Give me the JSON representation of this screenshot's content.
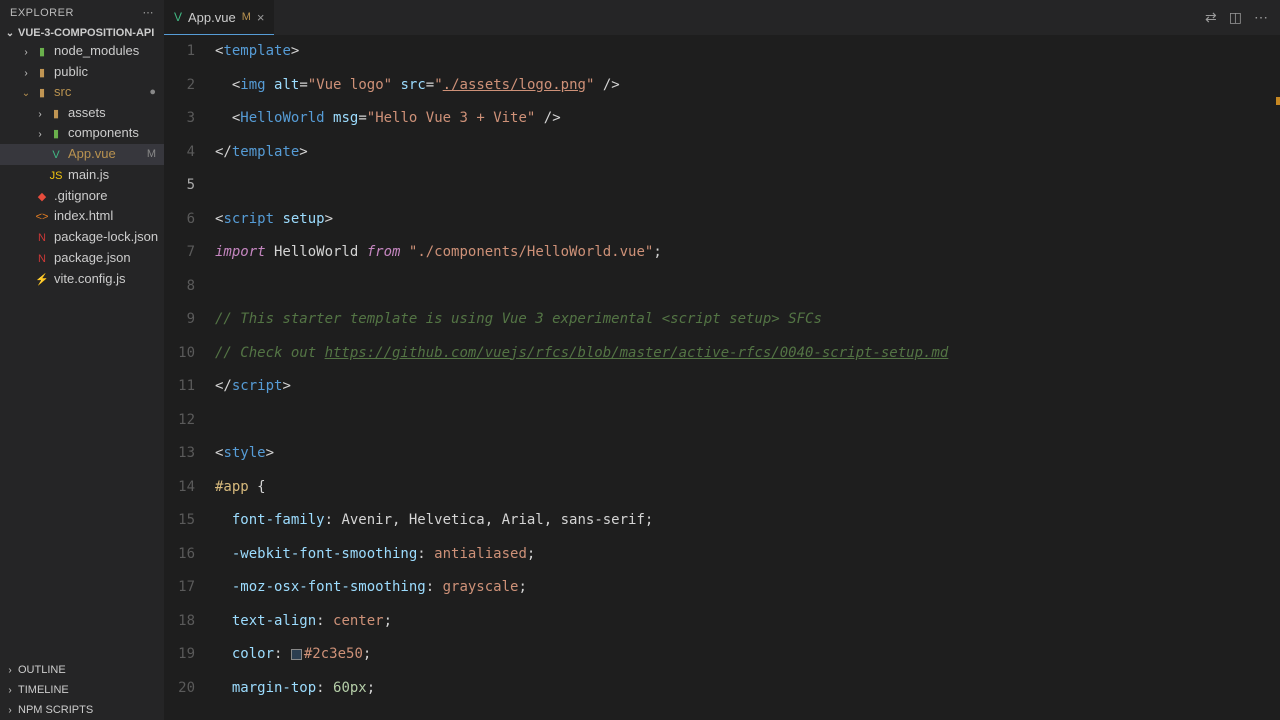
{
  "explorer": {
    "title": "EXPLORER",
    "project": "VUE-3-COMPOSITION-API",
    "tree": [
      {
        "name": "node_modules",
        "type": "folder",
        "indent": 1,
        "chev": "›",
        "iconClass": "folder-icon green"
      },
      {
        "name": "public",
        "type": "folder",
        "indent": 1,
        "chev": "›",
        "iconClass": "folder-icon"
      },
      {
        "name": "src",
        "type": "folder",
        "indent": 1,
        "chev": "⌄",
        "iconClass": "folder-icon",
        "modified": true,
        "badge": "●"
      },
      {
        "name": "assets",
        "type": "folder",
        "indent": 2,
        "chev": "›",
        "iconClass": "folder-icon"
      },
      {
        "name": "components",
        "type": "folder",
        "indent": 2,
        "chev": "›",
        "iconClass": "folder-icon green"
      },
      {
        "name": "App.vue",
        "type": "file",
        "indent": 2,
        "iconClass": "vue-icon",
        "iconText": "V",
        "modified": true,
        "badge": "M",
        "active": true
      },
      {
        "name": "main.js",
        "type": "file",
        "indent": 2,
        "iconClass": "js-icon",
        "iconText": "JS"
      },
      {
        "name": ".gitignore",
        "type": "file",
        "indent": 1,
        "iconClass": "git-icon",
        "iconText": "◆"
      },
      {
        "name": "index.html",
        "type": "file",
        "indent": 1,
        "iconClass": "html-icon",
        "iconText": "<>"
      },
      {
        "name": "package-lock.json",
        "type": "file",
        "indent": 1,
        "iconClass": "npm-icon",
        "iconText": "N"
      },
      {
        "name": "package.json",
        "type": "file",
        "indent": 1,
        "iconClass": "npm-icon",
        "iconText": "N"
      },
      {
        "name": "vite.config.js",
        "type": "file",
        "indent": 1,
        "iconClass": "js-icon",
        "iconText": "⚡"
      }
    ],
    "panels": [
      "OUTLINE",
      "TIMELINE",
      "NPM SCRIPTS"
    ]
  },
  "tabs": {
    "open": {
      "name": "App.vue",
      "status": "M"
    }
  },
  "editor": {
    "lines": [
      {
        "n": 1,
        "tokens": [
          [
            "punct",
            "<"
          ],
          [
            "tag",
            "template"
          ],
          [
            "punct",
            ">"
          ]
        ]
      },
      {
        "n": 2,
        "indent": 1,
        "tokens": [
          [
            "punct",
            "<"
          ],
          [
            "tag",
            "img"
          ],
          [
            "plain",
            " "
          ],
          [
            "attr",
            "alt"
          ],
          [
            "punct",
            "="
          ],
          [
            "str",
            "\"Vue logo\""
          ],
          [
            "plain",
            " "
          ],
          [
            "attr",
            "src"
          ],
          [
            "punct",
            "="
          ],
          [
            "str",
            "\""
          ],
          [
            "str-u",
            "./assets/logo.png"
          ],
          [
            "str",
            "\""
          ],
          [
            "plain",
            " "
          ],
          [
            "punct",
            "/>"
          ]
        ]
      },
      {
        "n": 3,
        "indent": 1,
        "tokens": [
          [
            "punct",
            "<"
          ],
          [
            "tag",
            "HelloWorld"
          ],
          [
            "plain",
            " "
          ],
          [
            "attr",
            "msg"
          ],
          [
            "punct",
            "="
          ],
          [
            "str",
            "\"Hello Vue 3 + Vite\""
          ],
          [
            "plain",
            " "
          ],
          [
            "punct",
            "/>"
          ]
        ]
      },
      {
        "n": 4,
        "tokens": [
          [
            "punct",
            "</"
          ],
          [
            "tag",
            "template"
          ],
          [
            "punct",
            ">"
          ]
        ]
      },
      {
        "n": 5,
        "active": true,
        "tokens": []
      },
      {
        "n": 6,
        "tokens": [
          [
            "punct",
            "<"
          ],
          [
            "tag",
            "script"
          ],
          [
            "plain",
            " "
          ],
          [
            "attr",
            "setup"
          ],
          [
            "punct",
            ">"
          ]
        ]
      },
      {
        "n": 7,
        "tokens": [
          [
            "kw",
            "import"
          ],
          [
            "plain",
            " HelloWorld "
          ],
          [
            "kw",
            "from"
          ],
          [
            "plain",
            " "
          ],
          [
            "str",
            "\"./components/HelloWorld.vue\""
          ],
          [
            "punct",
            ";"
          ]
        ]
      },
      {
        "n": 8,
        "tokens": []
      },
      {
        "n": 9,
        "tokens": [
          [
            "comment",
            "// This starter template is using Vue 3 experimental <script setup> SFCs"
          ]
        ]
      },
      {
        "n": 10,
        "tokens": [
          [
            "comment",
            "// Check out "
          ],
          [
            "comment-u",
            "https://github.com/vuejs/rfcs/blob/master/active-rfcs/0040-script-setup.md"
          ]
        ]
      },
      {
        "n": 11,
        "tokens": [
          [
            "punct",
            "</"
          ],
          [
            "tag",
            "script"
          ],
          [
            "punct",
            ">"
          ]
        ]
      },
      {
        "n": 12,
        "tokens": []
      },
      {
        "n": 13,
        "tokens": [
          [
            "punct",
            "<"
          ],
          [
            "tag",
            "style"
          ],
          [
            "punct",
            ">"
          ]
        ]
      },
      {
        "n": 14,
        "tokens": [
          [
            "sel",
            "#app"
          ],
          [
            "plain",
            " "
          ],
          [
            "punct",
            "{"
          ]
        ]
      },
      {
        "n": 15,
        "indent": 1,
        "tokens": [
          [
            "prop",
            "font-family"
          ],
          [
            "punct",
            ": "
          ],
          [
            "plain",
            "Avenir"
          ],
          [
            "punct",
            ", "
          ],
          [
            "plain",
            "Helvetica"
          ],
          [
            "punct",
            ", "
          ],
          [
            "plain",
            "Arial"
          ],
          [
            "punct",
            ", "
          ],
          [
            "plain",
            "sans-serif"
          ],
          [
            "punct",
            ";"
          ]
        ]
      },
      {
        "n": 16,
        "indent": 1,
        "tokens": [
          [
            "prop",
            "-webkit-font-smoothing"
          ],
          [
            "punct",
            ": "
          ],
          [
            "val",
            "antialiased"
          ],
          [
            "punct",
            ";"
          ]
        ]
      },
      {
        "n": 17,
        "indent": 1,
        "tokens": [
          [
            "prop",
            "-moz-osx-font-smoothing"
          ],
          [
            "punct",
            ": "
          ],
          [
            "val",
            "grayscale"
          ],
          [
            "punct",
            ";"
          ]
        ]
      },
      {
        "n": 18,
        "indent": 1,
        "tokens": [
          [
            "prop",
            "text-align"
          ],
          [
            "punct",
            ": "
          ],
          [
            "val",
            "center"
          ],
          [
            "punct",
            ";"
          ]
        ]
      },
      {
        "n": 19,
        "indent": 1,
        "tokens": [
          [
            "prop",
            "color"
          ],
          [
            "punct",
            ": "
          ],
          [
            "colorbox",
            ""
          ],
          [
            "val",
            "#2c3e50"
          ],
          [
            "punct",
            ";"
          ]
        ]
      },
      {
        "n": 20,
        "indent": 1,
        "tokens": [
          [
            "prop",
            "margin-top"
          ],
          [
            "punct",
            ": "
          ],
          [
            "num",
            "60px"
          ],
          [
            "punct",
            ";"
          ]
        ]
      }
    ]
  }
}
